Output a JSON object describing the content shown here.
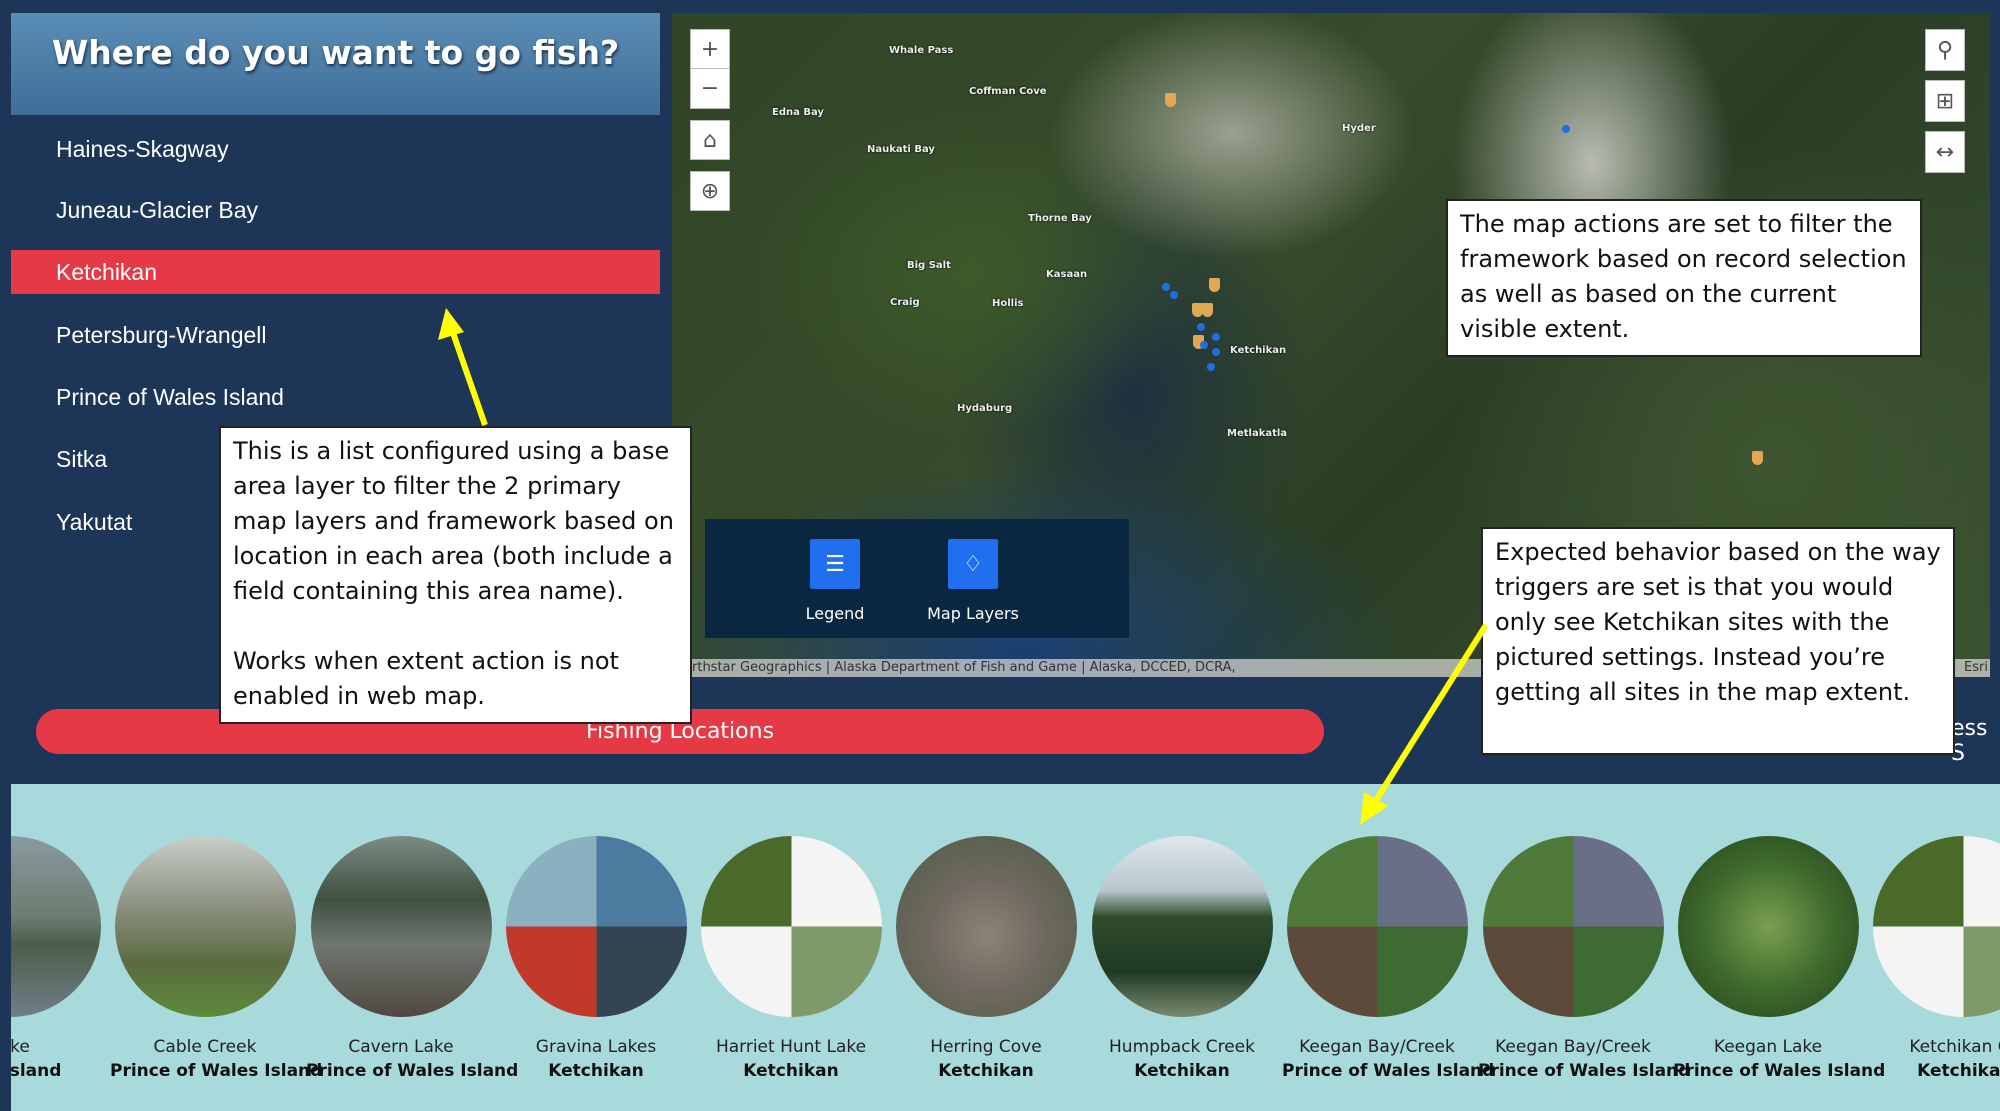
{
  "panel": {
    "title": "Where do you want to go fish?",
    "areas": [
      "Haines-Skagway",
      "Juneau-Glacier Bay",
      "Ketchikan",
      "Petersburg-Wrangell",
      "Prince of Wales Island",
      "Sitka",
      "Yakutat"
    ],
    "selected": "Ketchikan",
    "selected_color": "#e63946"
  },
  "map": {
    "place_labels": [
      "Whale Pass",
      "Coffman Cove",
      "Edna Bay",
      "Naukati Bay",
      "Thorne Bay",
      "Big Salt",
      "Kasaan",
      "Craig",
      "Hollis",
      "Hydaburg",
      "Ketchikan",
      "Metlakatla",
      "Hyder"
    ],
    "controls": {
      "zoom_in": "zoom-in",
      "zoom_out": "zoom-out",
      "home": "home",
      "locate": "locate",
      "search": "search",
      "select": "select",
      "measure": "measure"
    },
    "attribution": "rthstar Geographics | Alaska Department of Fish and Game | Alaska, DCCED, DCRA,",
    "esri": "Esri",
    "widgets": [
      {
        "label": "Legend",
        "icon": "list-icon"
      },
      {
        "label": "Map Layers",
        "icon": "layers-icon"
      }
    ],
    "marker_colors": {
      "site": "#e0a855",
      "selected": "#1e6fe0"
    }
  },
  "section_button": "Fishing Locations",
  "partial_button_text": "ess S",
  "gallery": [
    {
      "name": "Lake",
      "area": "ales Island"
    },
    {
      "name": "Cable Creek",
      "area": "Prince of Wales Island"
    },
    {
      "name": "Cavern Lake",
      "area": "Prince of Wales Island"
    },
    {
      "name": "Gravina Lakes",
      "area": "Ketchikan"
    },
    {
      "name": "Harriet Hunt Lake",
      "area": "Ketchikan"
    },
    {
      "name": "Herring Cove",
      "area": "Ketchikan"
    },
    {
      "name": "Humpback Creek",
      "area": "Ketchikan"
    },
    {
      "name": "Keegan Bay/Creek",
      "area": "Prince of Wales Island"
    },
    {
      "name": "Keegan Bay/Creek",
      "area": "Prince of Wales Island"
    },
    {
      "name": "Keegan Lake",
      "area": "Prince of Wales Island"
    },
    {
      "name": "Ketchikan Cr",
      "area": "Ketchikar"
    }
  ],
  "callouts": {
    "list": [
      "This is a list configured using a base area layer to filter the 2 primary map layers and framework based on location in each area (both include a field containing this area name).",
      "Works when extent action is not enabled in web map."
    ],
    "map_actions": "The map actions are set to filter the framework based on record selection as well as based on the current visible extent.",
    "expected": "Expected behavior based on the way triggers are set is that you would only see Ketchikan sites with the pictured settings. Instead you’re getting all sites in the map extent."
  },
  "annotation_color": "#ffff00"
}
